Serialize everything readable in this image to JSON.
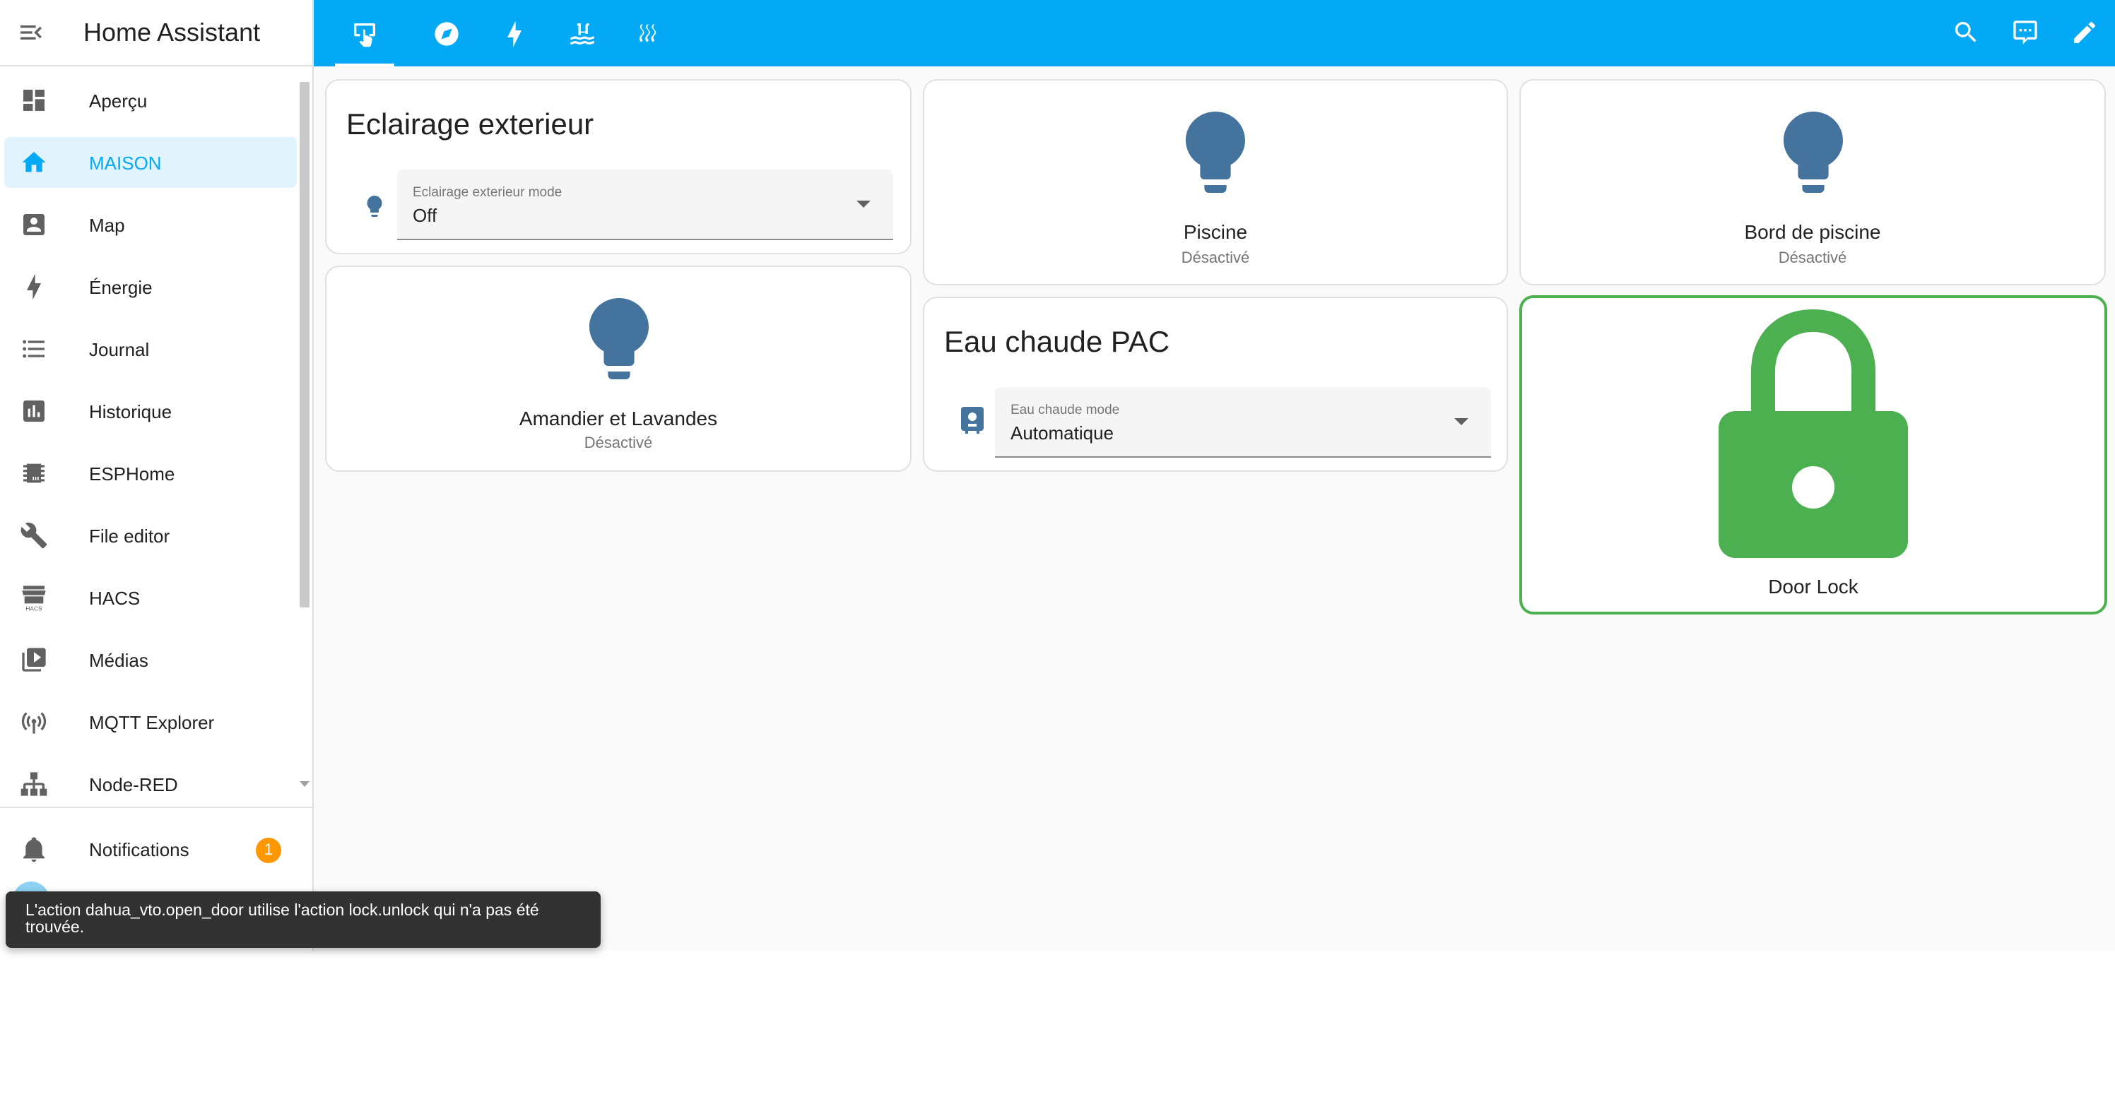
{
  "app": {
    "title": "Home Assistant"
  },
  "sidebar": {
    "items": [
      {
        "label": "Aperçu",
        "icon": "dashboard-icon"
      },
      {
        "label": "MAISON",
        "icon": "home-icon",
        "active": true
      },
      {
        "label": "Map",
        "icon": "map-account-icon"
      },
      {
        "label": "Énergie",
        "icon": "lightning-bolt-icon"
      },
      {
        "label": "Journal",
        "icon": "format-list-bulleted-icon"
      },
      {
        "label": "Historique",
        "icon": "chart-box-icon"
      },
      {
        "label": "ESPHome",
        "icon": "chip-icon"
      },
      {
        "label": "File editor",
        "icon": "wrench-icon"
      },
      {
        "label": "HACS",
        "icon": "hacs-icon",
        "icon_text": "HACS"
      },
      {
        "label": "Médias",
        "icon": "play-box-multiple-icon"
      },
      {
        "label": "MQTT Explorer",
        "icon": "access-point-network-icon"
      },
      {
        "label": "Node-RED",
        "icon": "sitemap-icon"
      }
    ],
    "notifications": {
      "label": "Notifications",
      "count": "1"
    }
  },
  "topbar": {
    "tabs": [
      {
        "icon": "gesture-tap-icon",
        "active": true
      },
      {
        "icon": "compass-icon"
      },
      {
        "icon": "lightning-bolt-icon"
      },
      {
        "icon": "pool-icon"
      },
      {
        "icon": "heat-wave-icon"
      }
    ],
    "actions": [
      {
        "icon": "search-icon"
      },
      {
        "icon": "assist-chat-icon"
      },
      {
        "icon": "pencil-icon"
      }
    ]
  },
  "cards": {
    "eclairage": {
      "title": "Eclairage exterieur",
      "select_label": "Eclairage exterieur mode",
      "select_value": "Off"
    },
    "piscine": {
      "name": "Piscine",
      "state": "Désactivé"
    },
    "bord_piscine": {
      "name": "Bord de piscine",
      "state": "Désactivé"
    },
    "amandier": {
      "name": "Amandier et Lavandes",
      "state": "Désactivé"
    },
    "eau_chaude": {
      "title": "Eau chaude PAC",
      "select_label": "Eau chaude mode",
      "select_value": "Automatique"
    },
    "door_lock": {
      "name": "Door Lock"
    }
  },
  "toast": {
    "message": "L'action dahua_vto.open_door utilise l'action lock.unlock qui n'a pas été trouvée."
  },
  "colors": {
    "primary": "#03a9f4",
    "state_icon": "#44739e",
    "lock_locked": "#4caf50",
    "badge": "#ff9800"
  }
}
